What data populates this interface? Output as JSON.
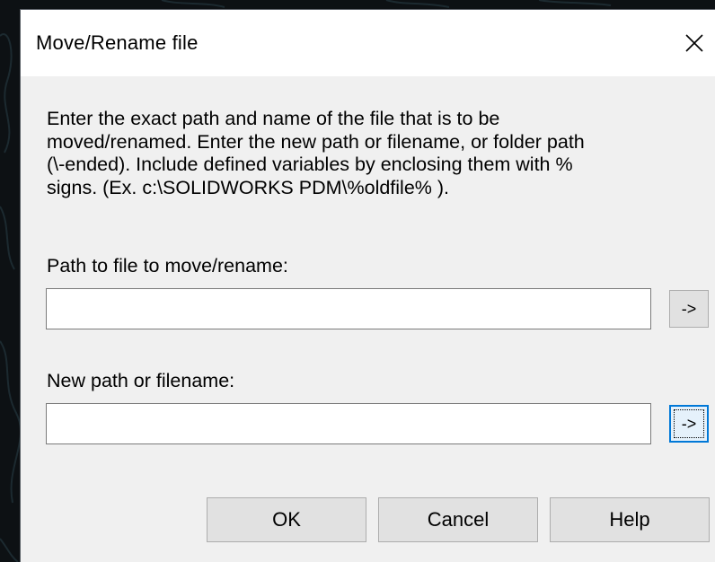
{
  "dialog": {
    "title": "Move/Rename file",
    "close_glyph": "✕",
    "description": "Enter the exact path and name of the file that is to be\nmoved/renamed. Enter the new path or filename, or folder path\n(\\-ended). Include defined variables by enclosing them with %\nsigns. (Ex. c:\\SOLIDWORKS PDM\\%oldfile% ).",
    "source": {
      "label": "Path to file to move/rename:",
      "value": "",
      "browse_label": "->"
    },
    "target": {
      "label": "New path or filename:",
      "value": "",
      "browse_label": "->"
    },
    "buttons": {
      "ok": "OK",
      "cancel": "Cancel",
      "help": "Help"
    }
  },
  "colors": {
    "dialog_bg": "#f0f0f0",
    "titlebar_bg": "#ffffff",
    "button_bg": "#e1e1e1",
    "focus_border": "#0078d7",
    "desktop_bg": "#0d1114"
  },
  "icons": {
    "close": "close-icon"
  }
}
